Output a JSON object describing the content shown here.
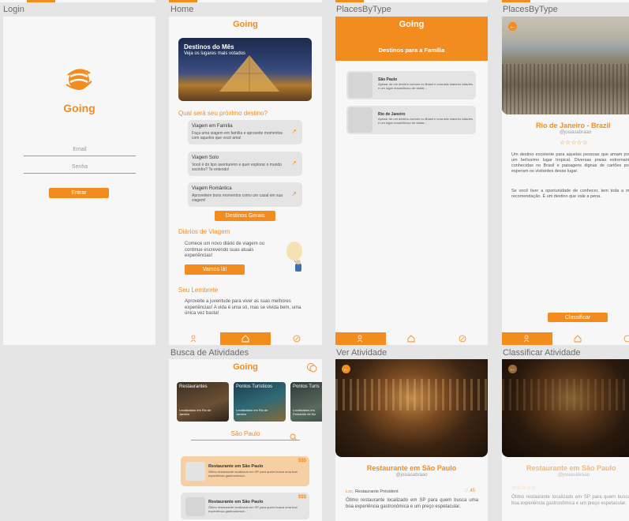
{
  "colors": {
    "accent": "#f28c1e",
    "screen_bg": "#f7f7f7",
    "canvas_bg": "#e5e5e5"
  },
  "frames": {
    "login": "Login",
    "home": "Home",
    "places1": "PlacesByType",
    "places2": "PlacesByType",
    "busca": "Busca de Atividades",
    "ver": "Ver Atividade",
    "classificar": "Classificar Atividade"
  },
  "login": {
    "app_name": "Going",
    "email_placeholder": "Email",
    "password_placeholder": "Senha",
    "enter_label": "Entrar"
  },
  "home": {
    "app_name": "Going",
    "banner_title": "Destinos do Mês",
    "banner_sub": "Veja os lugares mais votados",
    "question": "Qual será seu próximo destino?",
    "options": [
      {
        "title": "Viagem em Família",
        "desc": "Faça uma viagem em família e aproveite momentos com aqueles que você ama!"
      },
      {
        "title": "Viagem Solo",
        "desc": "Você é do tipo aventureiro e quer explorar o mundo sozinho? Te entendo!"
      },
      {
        "title": "Viagem Romântica",
        "desc": "Aproveitem bons momentos como um casal em sua viagem!"
      }
    ],
    "general_btn": "Destinos Gerais",
    "diary_title": "Diários de Viagem",
    "diary_text": "Comece um novo diário de viagem ou continue escrevendo suas atuais experiências!",
    "diary_btn": "Vamos lá!",
    "reminder_title": "Seu Lembrete",
    "reminder_text": "Aproveite a juventude para viver as suas melhores experiências! A vida é uma só, mas se vivida bem, uma única vez basta!"
  },
  "places": {
    "app_name": "Going",
    "subtitle": "Destinos para a Família",
    "items": [
      {
        "title": "São Paulo",
        "desc": "Apesar de um destino comum no Brasil e uma das maiores cidades e um lugar maravilhoso de visitar..."
      },
      {
        "title": "Rio de Janeiro",
        "desc": "Apesar de um destino comum no Brasil e uma das maiores cidades e um lugar maravilhoso de visitar..."
      }
    ]
  },
  "place_detail": {
    "title": "Rio de Janeiro - Brazil",
    "user": "@josiasabraao",
    "stars": "☆☆☆☆☆",
    "p1": "Um destino excelente para aquelas pessoas que amam praia e um belíssimo lugar tropical. Diversas praias extremamente conhecidas no Brasil e paisagens dignas de cartões postais esperam os visitantes desse lugar.",
    "p2": "Se você tiver a oportunidade de conhecer, tem toda a minha recomendação. É um destino que vale a pena.",
    "classify_btn": "Classificar"
  },
  "busca": {
    "app_name": "Going",
    "categories": [
      {
        "title": "Restaurantes",
        "loc": "Localizados em Rio de Janeiro"
      },
      {
        "title": "Pontos Turísticos",
        "loc": "Localizados em Rio de Janeiro"
      },
      {
        "title": "Pontos Turís",
        "loc": "Localizados em Fernando de No"
      }
    ],
    "search_value": "São Paulo",
    "results": [
      {
        "title": "Restaurante em São Paulo",
        "desc": "Ótimo restaurante localizado em SP para quem busca uma boa experiência gastronômica...",
        "price": "$$$"
      },
      {
        "title": "Restaurante em São Paulo",
        "desc": "Ótimo restaurante localizado em SP para quem busca uma boa experiência gastronômica...",
        "price": "$$$"
      }
    ]
  },
  "ver": {
    "title": "Restaurante em São Paulo",
    "user": "@josiasabraao",
    "loc_label": "Loc:",
    "loc_value": "Restaurante Président",
    "likes": "45",
    "desc": "Ótimo restaurante localizado em SP para quem busca uma boa experiência gastronômica e um preço espetacular."
  },
  "classificar": {
    "title": "Restaurante em São Paulo",
    "user": "@josiasabraao",
    "stars": "☆☆☆☆☆",
    "desc": "Ótimo restaurante localizado em SP para quem busca uma boa experiência gastronômica e um preço espetacular."
  }
}
